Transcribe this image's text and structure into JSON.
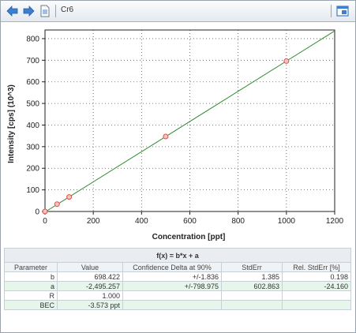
{
  "toolbar": {
    "title": "Cr6",
    "icons": [
      "back-arrow-icon",
      "forward-arrow-icon",
      "document-icon",
      "window-icon"
    ]
  },
  "chart_data": {
    "type": "scatter",
    "xlabel": "Concentration [ppt]",
    "ylabel": "Intensity [cps] (10^3)",
    "xlim": [
      0,
      1200
    ],
    "ylim": [
      0,
      840
    ],
    "xticks": [
      0,
      200,
      400,
      600,
      800,
      1000,
      1200
    ],
    "yticks": [
      0,
      100,
      200,
      300,
      400,
      500,
      600,
      700,
      800
    ],
    "grid": true,
    "points": [
      {
        "x": 0,
        "y": 0
      },
      {
        "x": 50,
        "y": 34
      },
      {
        "x": 100,
        "y": 67
      },
      {
        "x": 500,
        "y": 347
      },
      {
        "x": 1000,
        "y": 696
      }
    ],
    "fit": {
      "slope": 0.698422,
      "intercept": -2.495257
    },
    "colors": {
      "line": "#2e8b2e",
      "point": "#d9534f"
    }
  },
  "table": {
    "formula": "f(x) = b*x + a",
    "headers": [
      "Parameter",
      "Value",
      "Confidence Delta at 90%",
      "StdErr",
      "Rel. StdErr [%]"
    ],
    "rows": [
      [
        "b",
        "698.422",
        "+/-1.836",
        "1.385",
        "0.198"
      ],
      [
        "a",
        "-2,495.257",
        "+/-798.975",
        "602.863",
        "-24.160"
      ],
      [
        "R",
        "1.000",
        "",
        "",
        ""
      ],
      [
        "BEC",
        "-3.573 ppt",
        "",
        "",
        ""
      ]
    ]
  }
}
